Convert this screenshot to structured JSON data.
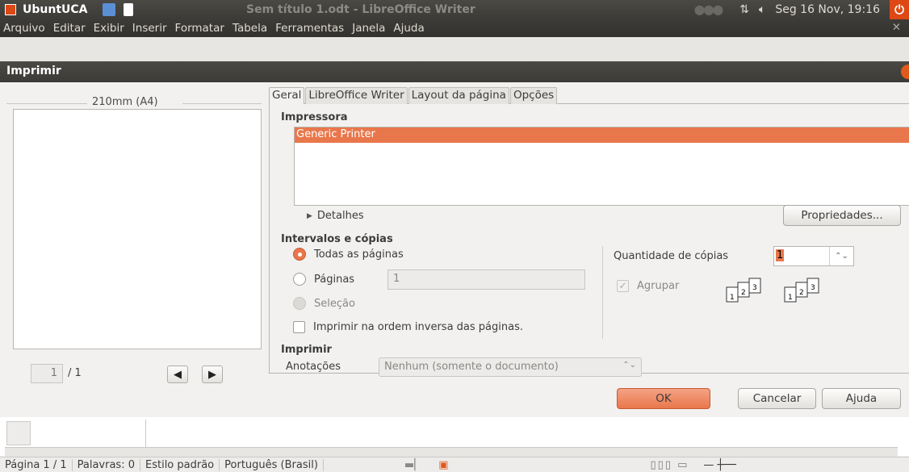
{
  "panel": {
    "os_name": "UbuntUCA",
    "window_title": "Sem título 1.odt - LibreOffice Writer",
    "clock": "Seg 16 Nov, 19:16"
  },
  "menu": [
    "Arquivo",
    "Editar",
    "Exibir",
    "Inserir",
    "Formatar",
    "Tabela",
    "Ferramentas",
    "Janela",
    "Ajuda"
  ],
  "dialog": {
    "title": "Imprimir",
    "preview": {
      "paper_label": "210mm (A4)",
      "page_value": "1",
      "page_total": "/ 1"
    },
    "tabs": [
      "Geral",
      "LibreOffice Writer",
      "Layout da página",
      "Opções"
    ],
    "printer": {
      "section": "Impressora",
      "selected": "Generic Printer",
      "details_label": "Detalhes",
      "properties_button": "Propriedades..."
    },
    "ranges": {
      "section": "Intervalos e cópias",
      "all_pages": "Todas as páginas",
      "pages": "Páginas",
      "pages_value": "1",
      "selection": "Seleção",
      "reverse": "Imprimir na ordem inversa das páginas.",
      "copies_label": "Quantidade de cópias",
      "copies_value": "1",
      "collate": "Agrupar"
    },
    "print_section": {
      "section": "Imprimir",
      "annotations_label": "Anotações",
      "annotations_value": "Nenhum (somente o documento)"
    },
    "buttons": {
      "ok": "OK",
      "cancel": "Cancelar",
      "help": "Ajuda"
    }
  },
  "statusbar": {
    "page": "Página 1 / 1",
    "words": "Palavras: 0",
    "style": "Estilo padrão",
    "language": "Português (Brasil)"
  },
  "colors": {
    "accent": "#e9774c",
    "panel": "#3c3b37"
  }
}
